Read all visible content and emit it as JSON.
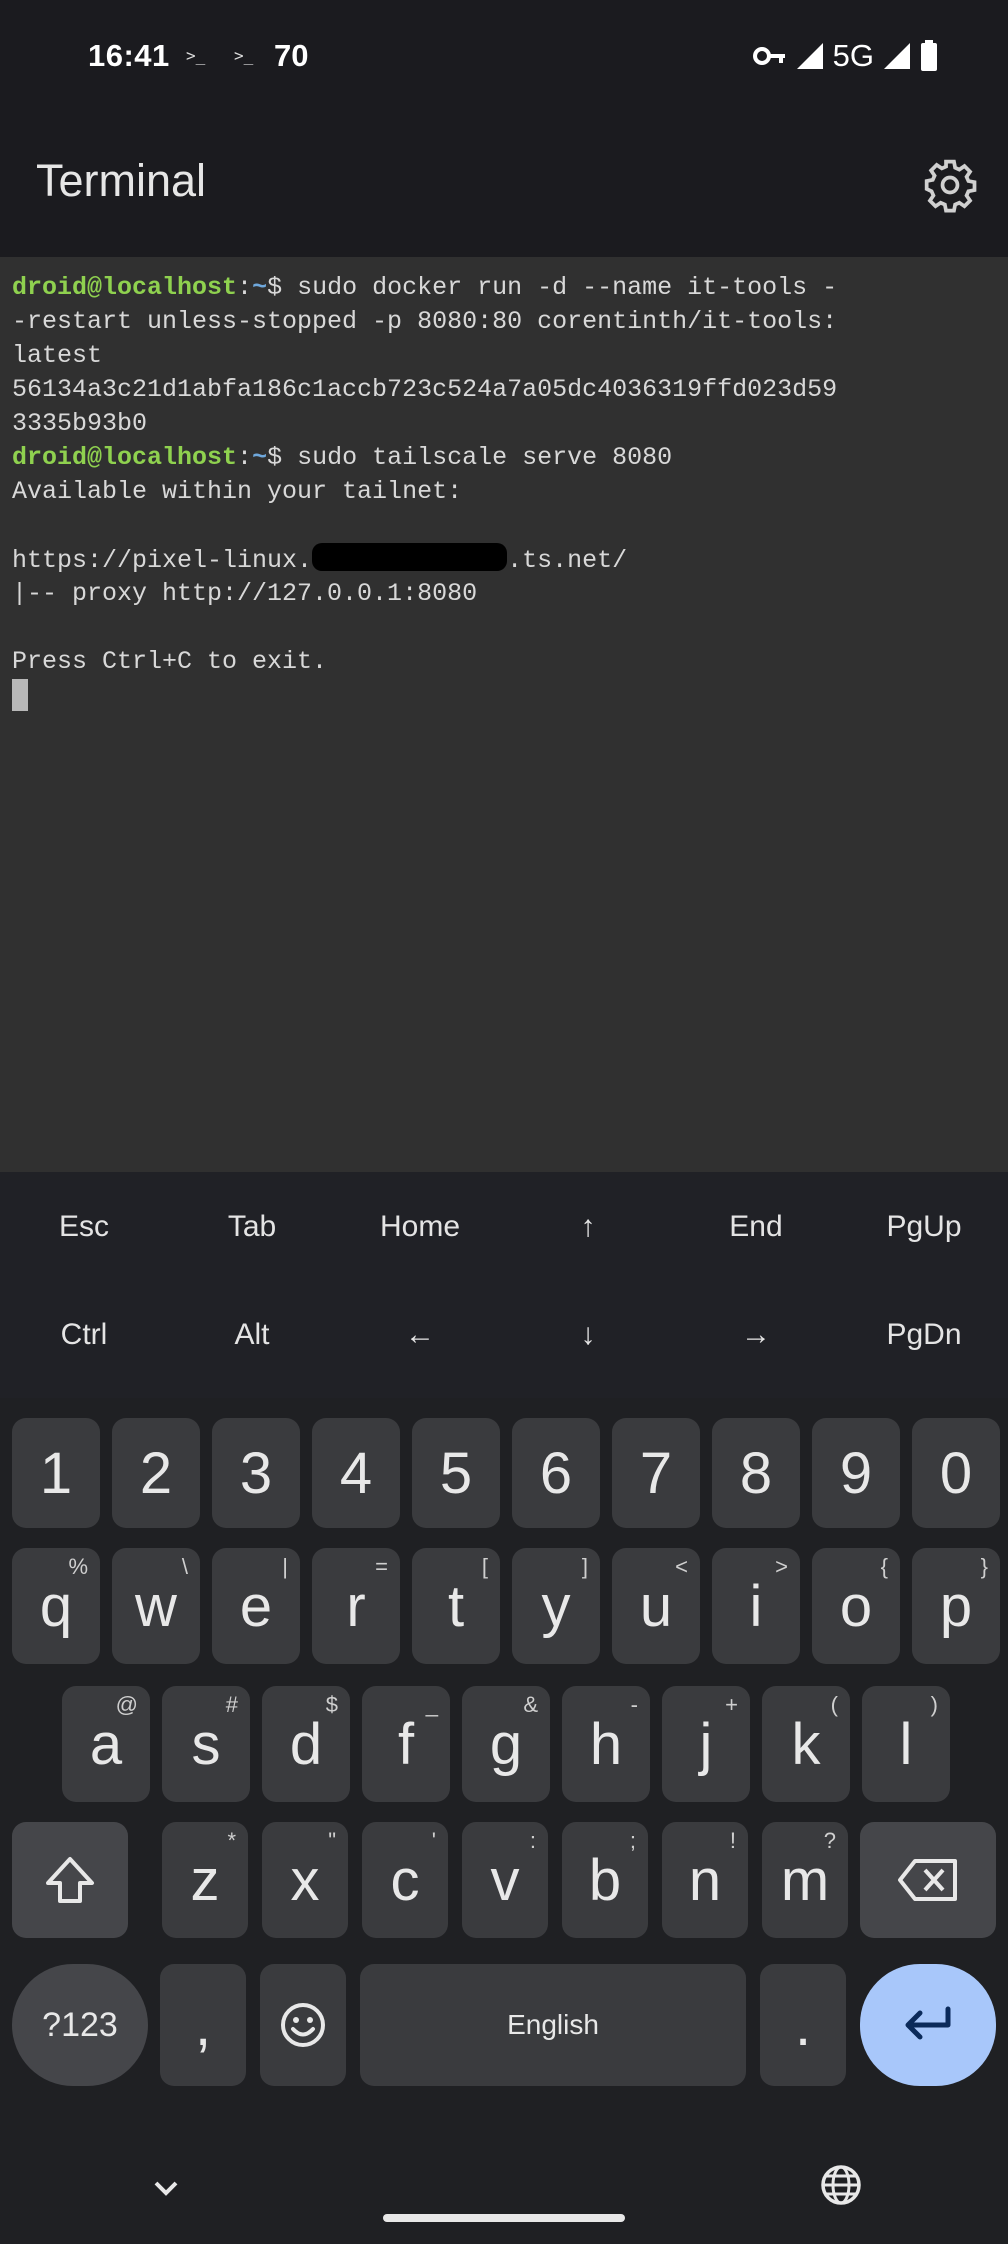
{
  "status_bar": {
    "time": "16:41",
    "icon_a": ">_",
    "icon_b": ">_",
    "battery_level": "70",
    "network": "5G"
  },
  "app": {
    "title": "Terminal"
  },
  "terminal": {
    "prompt_user": "droid@localhost",
    "prompt_sep": ":",
    "prompt_path": "~",
    "line1_cmd": "$ sudo docker run -d --name it-tools -",
    "line2": "-restart unless-stopped -p 8080:80 corentinth/it-tools:",
    "line3": "latest",
    "line4": "56134a3c21d1abfa186c1accb723c524a7a05dc4036319ffd023d59",
    "line5": "3335b93b0",
    "line6_cmd": "$ sudo tailscale serve 8080",
    "line7": "Available within your tailnet:",
    "url_prefix": "https://pixel-linux.",
    "url_suffix": ".ts.net/",
    "line9": "|-- proxy http://127.0.0.1:8080",
    "line11": "Press Ctrl+C to exit."
  },
  "extra_keys": {
    "row1": [
      "Esc",
      "Tab",
      "Home",
      "↑",
      "End",
      "PgUp"
    ],
    "row2": [
      "Ctrl",
      "Alt",
      "←",
      "↓",
      "→",
      "PgDn"
    ]
  },
  "keyboard": {
    "numbers": [
      "1",
      "2",
      "3",
      "4",
      "5",
      "6",
      "7",
      "8",
      "9",
      "0"
    ],
    "row_q": [
      "q",
      "w",
      "e",
      "r",
      "t",
      "y",
      "u",
      "i",
      "o",
      "p"
    ],
    "row_q_hints": [
      "%",
      "\\",
      "|",
      "=",
      "[",
      "]",
      "<",
      ">",
      "{",
      "}"
    ],
    "row_a": [
      "a",
      "s",
      "d",
      "f",
      "g",
      "h",
      "j",
      "k",
      "l"
    ],
    "row_a_hints": [
      "@",
      "#",
      "$",
      "_",
      "&",
      "-",
      "+",
      "(",
      ")"
    ],
    "row_z": [
      "z",
      "x",
      "c",
      "v",
      "b",
      "n",
      "m"
    ],
    "row_z_hints": [
      "*",
      "\"",
      "'",
      ":",
      ";",
      "!",
      "?"
    ],
    "symbols_label": "?123",
    "comma": ",",
    "space_label": "English",
    "period": "."
  },
  "colors": {
    "terminal_bg": "#303030",
    "prompt_user": "#8fd14f",
    "prompt_path": "#6fa8dc",
    "enter_key": "#a8c7fa"
  }
}
